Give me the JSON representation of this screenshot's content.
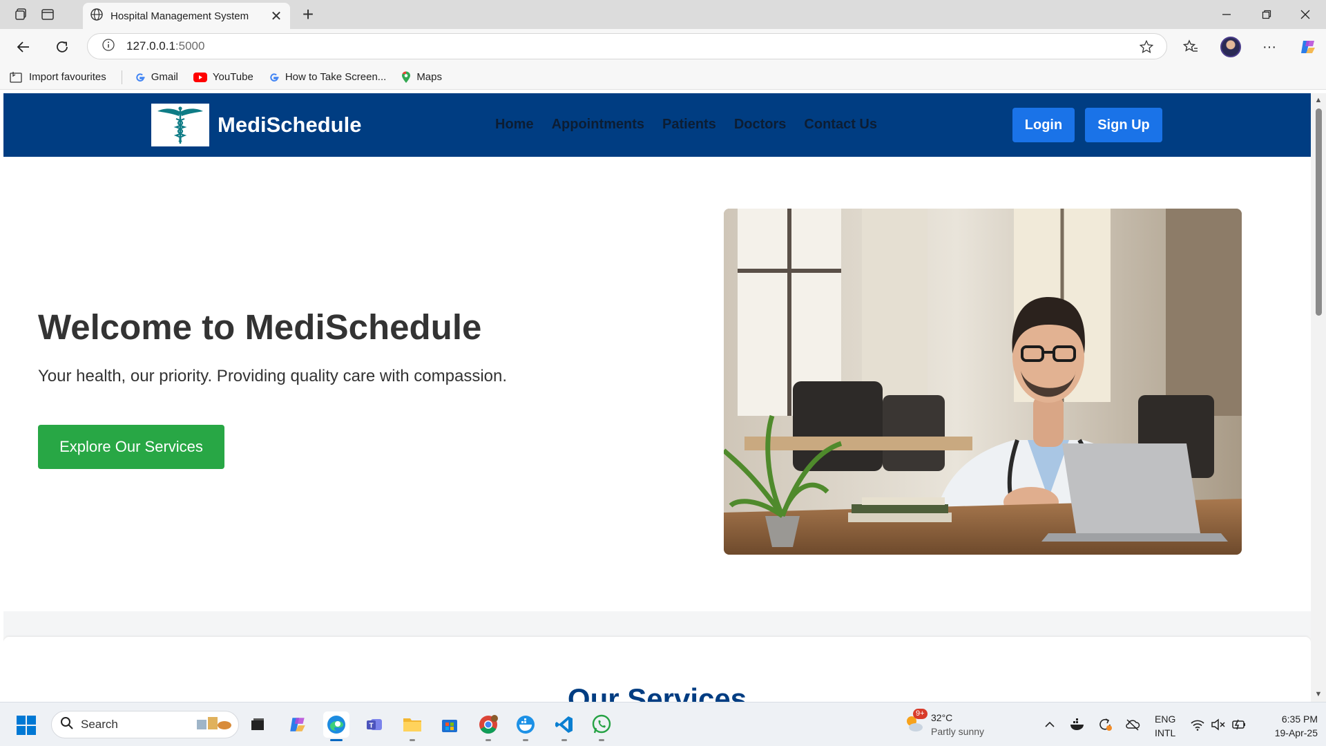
{
  "browser": {
    "tab_title": "Hospital Management System",
    "url_host": "127.0.0.1",
    "url_port": ":5000",
    "favourites": [
      {
        "label": "Import favourites",
        "icon": "import-icon"
      },
      {
        "label": "Gmail",
        "icon": "google-icon"
      },
      {
        "label": "YouTube",
        "icon": "youtube-icon"
      },
      {
        "label": "How to Take Screen...",
        "icon": "google-icon"
      },
      {
        "label": "Maps",
        "icon": "maps-pin-icon"
      }
    ]
  },
  "site": {
    "brand": "MediSchedule",
    "nav": [
      "Home",
      "Appointments",
      "Patients",
      "Doctors",
      "Contact Us"
    ],
    "login": "Login",
    "signup": "Sign Up",
    "colors": {
      "navbar": "#003d82",
      "button": "#1a73e8",
      "cta": "#28a745"
    }
  },
  "hero": {
    "title": "Welcome to MediSchedule",
    "subtitle": "Your health, our priority. Providing quality care with compassion.",
    "cta": "Explore Our Services",
    "image": "doctor-at-desk-photo"
  },
  "services": {
    "title": "Our Services"
  },
  "taskbar": {
    "search": "Search",
    "weather_badge": "9+",
    "temperature": "32°C",
    "condition": "Partly sunny",
    "lang_top": "ENG",
    "lang_bottom": "INTL",
    "time": "6:35 PM",
    "date": "19-Apr-25"
  }
}
